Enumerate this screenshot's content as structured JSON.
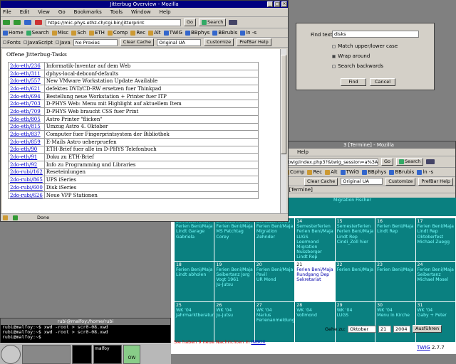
{
  "jitterbug": {
    "title": "Jitterbug Overview - Mozilla",
    "menu": [
      "File",
      "Edit",
      "View",
      "Go",
      "Bookmarks",
      "Tools",
      "Window",
      "Help"
    ],
    "url": "https://mic.phys.ethz.ch/cgi-bin/jitterprint",
    "go": "Go",
    "search": "Search",
    "bookmarks": [
      "Home",
      "Search",
      "Misc",
      "Sch",
      "ETH",
      "Comp",
      "Rec",
      "Alt",
      "TWiG",
      "BBphys",
      "BBrubis",
      "ln -s"
    ],
    "toolbar2": [
      "Fonts",
      "JavaScript",
      "Java"
    ],
    "proxy": "No Proxies",
    "clear_cache": "Clear Cache",
    "ua": "Original UA",
    "customize": "Customize",
    "prefbar_help": "PrefBar Help",
    "heading": "Offene Jitterbug-Tasks",
    "tasks": [
      {
        "id": "2do-eth/236",
        "text": "Informatik-Inventar auf dem Web"
      },
      {
        "id": "2do-eth/311",
        "text": "dphys-local-debconf-defaults"
      },
      {
        "id": "2do-eth/557",
        "text": "New VMware Workstation Update Available"
      },
      {
        "id": "2do-eth/621",
        "text": "defektes DVD/CD-RW ersetzen fuer Thinkpad"
      },
      {
        "id": "2do-eth/694",
        "text": "Bestellung neue Workstation + Printer fuer ITP"
      },
      {
        "id": "2do-eth/703",
        "text": "D-PHYS Web: Menu mit Highlight auf aktuellem Item"
      },
      {
        "id": "2do-eth/709",
        "text": "D-PHYS Web braucht CSS fuer Print"
      },
      {
        "id": "2do-eth/805",
        "text": "Astro Printer \"flicken\""
      },
      {
        "id": "2do-eth/815",
        "text": "Umzug Astro 4. Oktober"
      },
      {
        "id": "2do-eth/837",
        "text": "Computer fuer Fingerprintsystem der Bibliothek"
      },
      {
        "id": "2do-eth/859",
        "text": "E-Mails Astro ueberpruefen"
      },
      {
        "id": "2do-eth/90",
        "text": "ETH-Brief fuer alle im D-PHYS Telefonbuch"
      },
      {
        "id": "2do-eth/91",
        "text": "Doku zu ETH-Brief"
      },
      {
        "id": "2do-eth/92",
        "text": "Info zu Programming und Libraries"
      },
      {
        "id": "2do-rubi/162",
        "text": "Reseteinlungen"
      },
      {
        "id": "2do-rubi/865",
        "text": "UPS iSeries"
      },
      {
        "id": "2do-rubi/600",
        "text": "Disk iSeries"
      },
      {
        "id": "2do-rubi/626",
        "text": "Neue VPP Stationen"
      }
    ],
    "status": "Done"
  },
  "find": {
    "label": "Find text:",
    "value": "disks",
    "match_case": "Match upper/lower case",
    "wrap": "Wrap around",
    "backwards": "Search backwards",
    "find_btn": "Find",
    "cancel_btn": "Cancel"
  },
  "twig": {
    "title": "3 [Termine] - Mozilla",
    "menu": [
      "Help"
    ],
    "url": "/twig/index.php3?&twig_session=a%3A139",
    "go": "Go",
    "search": "Search",
    "bookmarks": [
      "Comp",
      "Rec",
      "Alt",
      "TWiG",
      "BBphys",
      "BBrubis",
      "ln -s"
    ],
    "clear_cache": "Clear Cache",
    "ua": "Original UA",
    "customize": "Customize",
    "prefbar_help": "PrefBar Help",
    "tab": "3 [Termine]",
    "top_row": [
      "",
      "",
      "",
      "Migration Fischer",
      "",
      ""
    ],
    "weeks": [
      [
        {
          "d": "",
          "t": "Semesterferien\nFerien Beni/Maja\nLindt Garage\nGabriela"
        },
        {
          "d": "",
          "t": "Semesterferien\nFerien Beni/Maja\nMS Patchtag\nCorey"
        },
        {
          "d": "",
          "t": "Semesterferien\nFerien Beni/Maja\nMigration Zehnder"
        },
        {
          "d": "14",
          "t": "Semesterferien\nFerien Beni/Maja\nLUGS\nLeermond\nMigration\nNussberger\nLindt Rep"
        },
        {
          "d": "15",
          "t": "Semesterferien\nFerien Beni/Maja\nLindt Rep\nCindi_Zoll hier"
        },
        {
          "d": "16",
          "t": "Ferien Beni/Maja\nLindt Rep"
        },
        {
          "d": "17",
          "t": "Ferien Beni/Maja\nLindt Rep\nOktoberfest\nMichael Zuegg"
        }
      ],
      [
        {
          "d": "18",
          "t": "Ferien Beni/Maja\nLindt abholen"
        },
        {
          "d": "19",
          "t": "Ferien Beni/Maja\nSeibertanz Jorg\nVogt 1961\nJu-Jutsu"
        },
        {
          "d": "20",
          "t": "Ferien Beni/Maja\nPavil\nUR Mond"
        },
        {
          "d": "21",
          "t": "Ferien Beni/Maja\nRundgang Dep\nSekretariat",
          "today": true
        },
        {
          "d": "22",
          "t": "Ferien Beni/Maja"
        },
        {
          "d": "23",
          "t": "Ferien Beni/Maja"
        },
        {
          "d": "24",
          "t": "Ferien Beni/Maja\nSeibertanz\nMichael Mosel"
        }
      ],
      [
        {
          "d": "25",
          "t": "WK '04\nJahrmarktberatung"
        },
        {
          "d": "26",
          "t": "WK '04\nJu-Jutsu"
        },
        {
          "d": "27",
          "t": "WK '04\nMarius\nFerienanmeldung"
        },
        {
          "d": "28",
          "t": "WK '04\nVollmond"
        },
        {
          "d": "29",
          "t": "WK '04\nLUGS"
        },
        {
          "d": "30",
          "t": "WK '04\nMenu in Kirche"
        },
        {
          "d": "31",
          "t": "WK '04\nGaby + Peter"
        }
      ]
    ],
    "gehe_zu": "Gehe zu:",
    "month": "Oktober",
    "day": "21",
    "year": "2004",
    "ausfuehren": "Ausführen",
    "news": "Sie haben 9 neue Nachrichten in",
    "inbox": "INBOX",
    "twig_link": "TWIG",
    "version": "2.7.7"
  },
  "terminal": {
    "title": "rubi@malfoy:/home/rubi",
    "lines": [
      "rubi@malfoy:~$ xwd -root > scr0-08.xwd",
      "rubi@malfoy:~$ xwd -root > scr0-08.xwd",
      "rubi@malfoy:~$ "
    ]
  },
  "panel": {
    "host": "malfoy",
    "mail": "OW"
  }
}
